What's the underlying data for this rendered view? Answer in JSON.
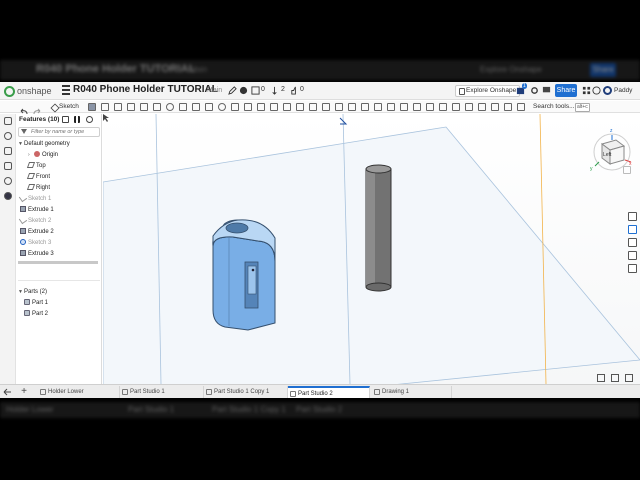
{
  "ghost": {
    "top_title": "R040 Phone Holder TUTORIAL",
    "top_branch": "Main",
    "top_explore": "Explore Onshape",
    "top_share": "Share",
    "bottom_tabs": [
      "Holder Lower",
      "Part Studio 1",
      "Part Studio 1 Copy 1",
      "Part Studio 2"
    ]
  },
  "header": {
    "logo_text": "onshape",
    "title": "R040 Phone Holder TUTORIAL",
    "branch": "Main",
    "globe_count": "0",
    "versions_count": "2",
    "likes_count": "0",
    "explore_label": "Explore Onshape",
    "notifications_badge": "1",
    "share_label": "Share",
    "user_name": "Paddy"
  },
  "toolbar": {
    "sketch_label": "Sketch",
    "search_label": "Search tools...",
    "search_shortcut": "alt+c"
  },
  "features": {
    "title": "Features (10)",
    "filter_placeholder": "Filter by name or type",
    "default_geometry": "Default geometry",
    "origin": "Origin",
    "top": "Top",
    "front": "Front",
    "right": "Right",
    "sketch1": "Sketch 1",
    "extrude1": "Extrude 1",
    "sketch2": "Sketch 2",
    "extrude2": "Extrude 2",
    "sketch3": "Sketch 3",
    "extrude3": "Extrude 3",
    "parts_header": "Parts (2)",
    "part1": "Part 1",
    "part2": "Part 2"
  },
  "viewcube": {
    "face_label": "Left",
    "axis_x": "x",
    "axis_y": "y",
    "axis_z": "z"
  },
  "tabs": [
    {
      "label": "Holder Lower",
      "active": false
    },
    {
      "label": "Part Studio 1",
      "active": false
    },
    {
      "label": "Part Studio 1 Copy 1",
      "active": false
    },
    {
      "label": "Part Studio 2",
      "active": true
    },
    {
      "label": "Drawing 1",
      "active": false
    }
  ],
  "colors": {
    "accent": "#1f6fd1",
    "brand_green": "#3a9d4a",
    "part_blue": "#7fb0e6",
    "part_gray": "#6f6f6f",
    "plane_line": "#9bbbd8"
  }
}
